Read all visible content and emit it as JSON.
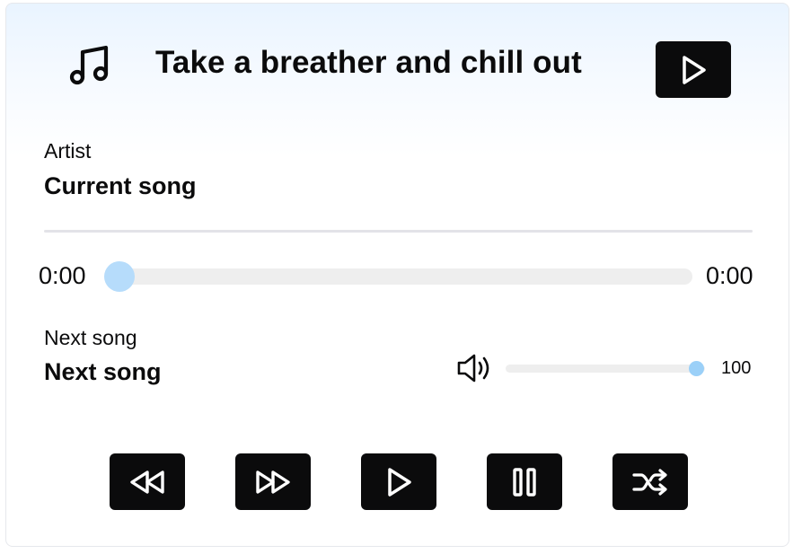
{
  "header": {
    "title": "Take a breather and chill out",
    "music_icon": "music-note-icon",
    "play_icon": "play-icon"
  },
  "current": {
    "artist_label": "Artist",
    "song_title": "Current song"
  },
  "progress": {
    "elapsed": "0:00",
    "duration": "0:00",
    "fraction": 0
  },
  "next": {
    "label": "Next song",
    "song_title": "Next song"
  },
  "volume": {
    "icon": "speaker-volume-icon",
    "value": "100",
    "level": 100
  },
  "controls": [
    {
      "name": "rewind",
      "icon": "rewind-icon"
    },
    {
      "name": "fast-forward",
      "icon": "fast-forward-icon"
    },
    {
      "name": "play",
      "icon": "play-icon"
    },
    {
      "name": "pause",
      "icon": "pause-icon"
    },
    {
      "name": "shuffle",
      "icon": "shuffle-icon"
    }
  ],
  "colors": {
    "button_bg": "#0b0b0c",
    "accent": "#b6dcfb",
    "track": "#eeeeee"
  }
}
